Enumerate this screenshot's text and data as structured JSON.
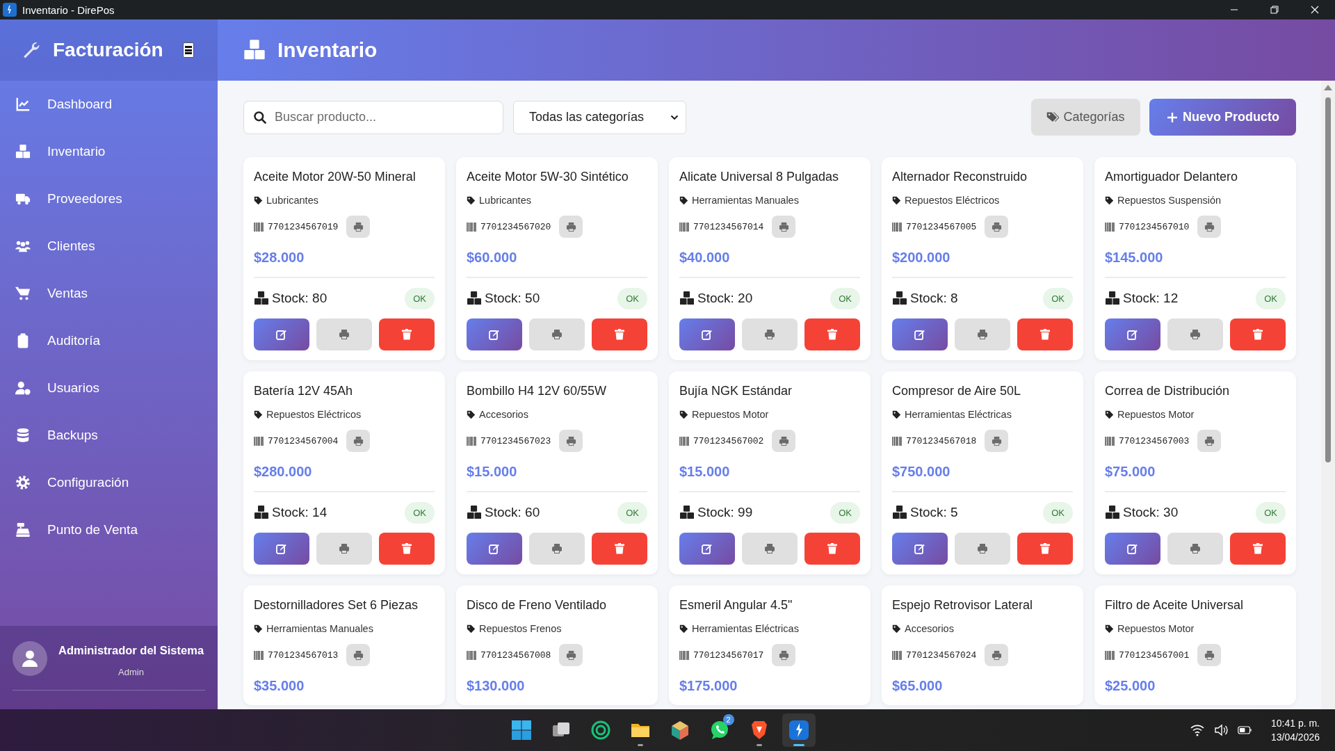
{
  "window": {
    "title": "Inventario - DirePos"
  },
  "sidebar": {
    "brand": "Facturación",
    "items": [
      {
        "label": "Dashboard"
      },
      {
        "label": "Inventario"
      },
      {
        "label": "Proveedores"
      },
      {
        "label": "Clientes"
      },
      {
        "label": "Ventas"
      },
      {
        "label": "Auditoría"
      },
      {
        "label": "Usuarios"
      },
      {
        "label": "Backups"
      },
      {
        "label": "Configuración"
      },
      {
        "label": "Punto de Venta"
      }
    ],
    "user": {
      "name": "Administrador del Sistema",
      "role": "Admin"
    }
  },
  "header": {
    "title": "Inventario"
  },
  "toolbar": {
    "search": {
      "placeholder": "Buscar producto..."
    },
    "category_filter": {
      "value": "Todas las categorías"
    },
    "buttons": [
      {
        "kind": "secondary",
        "label": "Categorías"
      },
      {
        "kind": "primary",
        "label": "Nuevo Producto"
      }
    ]
  },
  "products": [
    {
      "name": "Aceite Motor 20W-50 Mineral",
      "category": "Lubricantes",
      "barcode": "7701234567019",
      "price": "$28.000",
      "stock": "Stock: 80",
      "status": "OK"
    },
    {
      "name": "Aceite Motor 5W-30 Sintético",
      "category": "Lubricantes",
      "barcode": "7701234567020",
      "price": "$60.000",
      "stock": "Stock: 50",
      "status": "OK"
    },
    {
      "name": "Alicate Universal 8 Pulgadas",
      "category": "Herramientas Manuales",
      "barcode": "7701234567014",
      "price": "$40.000",
      "stock": "Stock: 20",
      "status": "OK"
    },
    {
      "name": "Alternador Reconstruido",
      "category": "Repuestos Eléctricos",
      "barcode": "7701234567005",
      "price": "$200.000",
      "stock": "Stock: 8",
      "status": "OK"
    },
    {
      "name": "Amortiguador Delantero",
      "category": "Repuestos Suspensión",
      "barcode": "7701234567010",
      "price": "$145.000",
      "stock": "Stock: 12",
      "status": "OK"
    },
    {
      "name": "Batería 12V 45Ah",
      "category": "Repuestos Eléctricos",
      "barcode": "7701234567004",
      "price": "$280.000",
      "stock": "Stock: 14",
      "status": "OK"
    },
    {
      "name": "Bombillo H4 12V 60/55W",
      "category": "Accesorios",
      "barcode": "7701234567023",
      "price": "$15.000",
      "stock": "Stock: 60",
      "status": "OK"
    },
    {
      "name": "Bujía NGK Estándar",
      "category": "Repuestos Motor",
      "barcode": "7701234567002",
      "price": "$15.000",
      "stock": "Stock: 99",
      "status": "OK"
    },
    {
      "name": "Compresor de Aire 50L",
      "category": "Herramientas Eléctricas",
      "barcode": "7701234567018",
      "price": "$750.000",
      "stock": "Stock: 5",
      "status": "OK"
    },
    {
      "name": "Correa de Distribución",
      "category": "Repuestos Motor",
      "barcode": "7701234567003",
      "price": "$75.000",
      "stock": "Stock: 30",
      "status": "OK"
    },
    {
      "name": "Destornilladores Set 6 Piezas",
      "category": "Herramientas Manuales",
      "barcode": "7701234567013",
      "price": "$35.000"
    },
    {
      "name": "Disco de Freno Ventilado",
      "category": "Repuestos Frenos",
      "barcode": "7701234567008",
      "price": "$130.000"
    },
    {
      "name": "Esmeril Angular 4.5\"",
      "category": "Herramientas Eléctricas",
      "barcode": "7701234567017",
      "price": "$175.000"
    },
    {
      "name": "Espejo Retrovisor Lateral",
      "category": "Accesorios",
      "barcode": "7701234567024",
      "price": "$65.000"
    },
    {
      "name": "Filtro de Aceite Universal",
      "category": "Repuestos Motor",
      "barcode": "7701234567001",
      "price": "$25.000"
    }
  ],
  "taskbar": {
    "apps": [
      {
        "running": false,
        "selected": false
      },
      {
        "running": false,
        "selected": false
      },
      {
        "running": false,
        "selected": false
      },
      {
        "running": true,
        "selected": false
      },
      {
        "running": false,
        "selected": false
      },
      {
        "running": false,
        "selected": false,
        "badge": "2"
      },
      {
        "running": true,
        "selected": false
      },
      {
        "running": true,
        "selected": true
      }
    ],
    "time": "10:41 p. m.",
    "date": "13/04/2026"
  }
}
